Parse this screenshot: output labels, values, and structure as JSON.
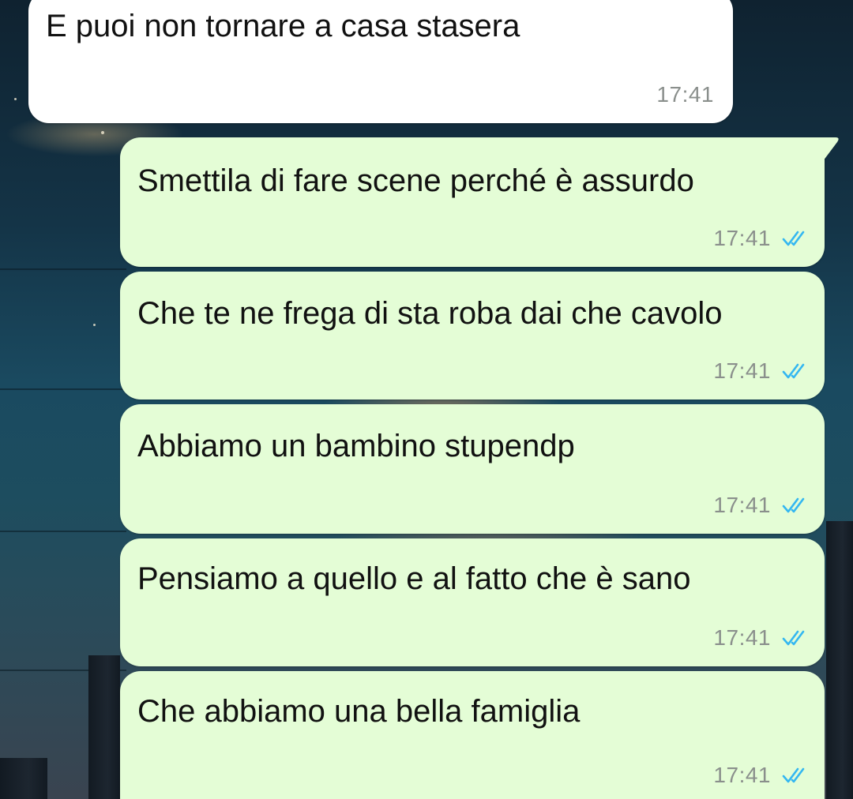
{
  "colors": {
    "incoming_bubble": "#ffffff",
    "outgoing_bubble": "#e4fdd6",
    "read_ticks": "#34b7f1",
    "timestamp": "#8a8f8c"
  },
  "messages": [
    {
      "direction": "incoming",
      "text": "E puoi non tornare a casa stasera",
      "time": "17:41"
    },
    {
      "direction": "outgoing",
      "text": "Smettila di fare scene perché è assurdo",
      "time": "17:41",
      "status_icon": "double-check-read-icon"
    },
    {
      "direction": "outgoing",
      "text": "Che te ne frega di sta roba dai che cavolo",
      "time": "17:41",
      "status_icon": "double-check-read-icon"
    },
    {
      "direction": "outgoing",
      "text": "Abbiamo un bambino stupendp",
      "time": "17:41",
      "status_icon": "double-check-read-icon"
    },
    {
      "direction": "outgoing",
      "text": "Pensiamo a quello e al fatto che è sano",
      "time": "17:41",
      "status_icon": "double-check-read-icon"
    },
    {
      "direction": "outgoing",
      "text": "Che abbiamo una bella famiglia",
      "time": "17:41",
      "status_icon": "double-check-read-icon"
    }
  ]
}
